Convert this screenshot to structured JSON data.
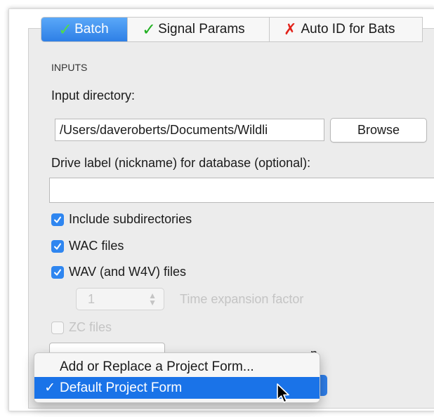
{
  "tabs": [
    {
      "label": "Batch",
      "status": "check"
    },
    {
      "label": "Signal Params",
      "status": "check"
    },
    {
      "label": "Auto ID for Bats",
      "status": "cross"
    }
  ],
  "inputs": {
    "section_title": "INPUTS",
    "input_directory_label": "Input directory:",
    "input_directory_value": "/Users/daveroberts/Documents/Wildli",
    "browse_label": "Browse",
    "drive_label_label": "Drive label (nickname) for database (optional):",
    "drive_label_value": ""
  },
  "options": [
    {
      "label": "Include subdirectories",
      "checked": true,
      "enabled": true
    },
    {
      "label": "WAC files",
      "checked": true,
      "enabled": true
    },
    {
      "label": "WAV (and W4V) files",
      "checked": true,
      "enabled": true
    }
  ],
  "time_expansion": {
    "value": "1",
    "label": "Time expansion factor",
    "enabled": false
  },
  "zc_files": {
    "label": "ZC files",
    "checked": false,
    "enabled": false
  },
  "partial_label": "n",
  "menu": {
    "items": [
      {
        "label": "Add or Replace a Project Form...",
        "checked": false
      },
      {
        "label": "Default Project Form",
        "checked": true
      }
    ],
    "check_glyph": "✓"
  },
  "colors": {
    "accent": "#2f86f0",
    "ok": "#21b021",
    "bad": "#e2231a"
  }
}
